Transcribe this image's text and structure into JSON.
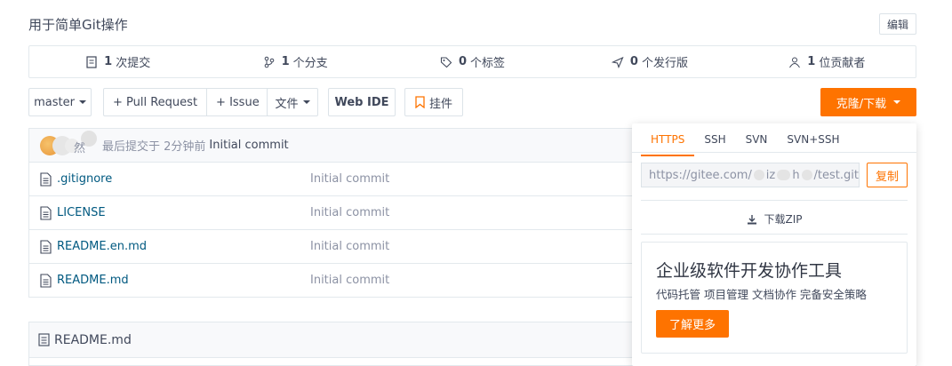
{
  "repo": {
    "description": "用于简单Git操作",
    "edit_label": "编辑"
  },
  "stats": [
    {
      "icon": "commits-icon",
      "count": "1",
      "label": "次提交"
    },
    {
      "icon": "branch-icon",
      "count": "1",
      "label": "个分支"
    },
    {
      "icon": "tag-icon",
      "count": "0",
      "label": "个标签"
    },
    {
      "icon": "release-icon",
      "count": "0",
      "label": "个发行版"
    },
    {
      "icon": "contributors-icon",
      "count": "1",
      "label": "位贡献者"
    }
  ],
  "toolbar": {
    "branch": "master",
    "pull_request": "+ Pull Request",
    "issue": "+ Issue",
    "files": "文件",
    "web_ide": "Web IDE",
    "widget": "挂件",
    "clone": "克隆/下载"
  },
  "latest_commit": {
    "author_fragment": "然",
    "meta": "最后提交于 2分钟前",
    "message": "Initial commit"
  },
  "files": [
    {
      "name": ".gitignore",
      "commit": "Initial commit"
    },
    {
      "name": "LICENSE",
      "commit": "Initial commit"
    },
    {
      "name": "README.en.md",
      "commit": "Initial commit"
    },
    {
      "name": "README.md",
      "commit": "Initial commit"
    }
  ],
  "readme": {
    "title": "README.md"
  },
  "clone_dropdown": {
    "tabs": [
      "HTTPS",
      "SSH",
      "SVN",
      "SVN+SSH"
    ],
    "active_tab": "HTTPS",
    "url": "https://gitee.com/",
    "url_fragment": "iz",
    "url_fragment2": "h",
    "url_suffix": "/test.git",
    "copy_label": "复制",
    "zip_label": "下载ZIP"
  },
  "ad": {
    "title": "企业级软件开发协作工具",
    "subtitle": "代码托管 项目管理 文档协作 完备安全策略",
    "button": "了解更多"
  },
  "colors": {
    "accent": "#fe7300",
    "link": "#005980",
    "muted": "#8c92a4"
  }
}
